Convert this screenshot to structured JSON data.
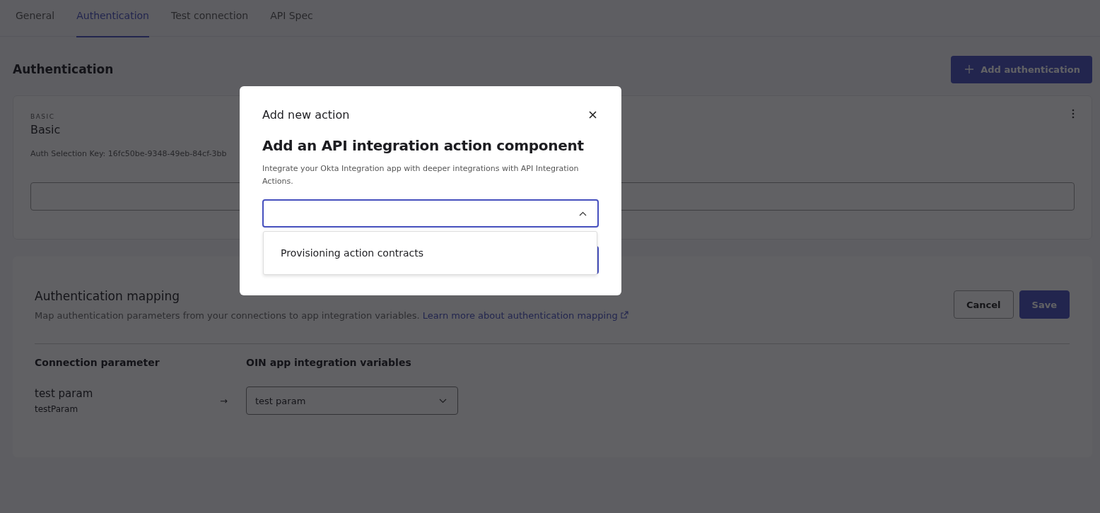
{
  "tabs": [
    {
      "label": "General",
      "selected": false
    },
    {
      "label": "Authentication",
      "selected": true
    },
    {
      "label": "Test connection",
      "selected": false
    },
    {
      "label": "API Spec",
      "selected": false
    }
  ],
  "section": {
    "title": "Authentication",
    "add_button": "Add authentication"
  },
  "auth_card": {
    "type_label": "BASIC",
    "title": "Basic",
    "selection_key": "Auth Selection Key: 16fc50be-9348-49eb-84cf-3bb"
  },
  "mapping": {
    "title": "Authentication mapping",
    "description": "Map authentication parameters from your connections to app integration variables.",
    "link": "Learn more about authentication mapping",
    "buttons": [
      "Cancel",
      "Save"
    ],
    "columns": [
      "Connection parameter",
      "OIN app integration variables"
    ],
    "rows": [
      {
        "name": "test param",
        "key": "testParam",
        "arrow": "→",
        "value": "test param"
      }
    ]
  },
  "modal": {
    "title": "Add new action",
    "heading": "Add an API integration action component",
    "description": "Integrate your Okta Integration app with deeper integrations with API Integration Actions.",
    "select": {
      "expanded": true
    },
    "options": [
      "Provisioning action contracts"
    ]
  }
}
